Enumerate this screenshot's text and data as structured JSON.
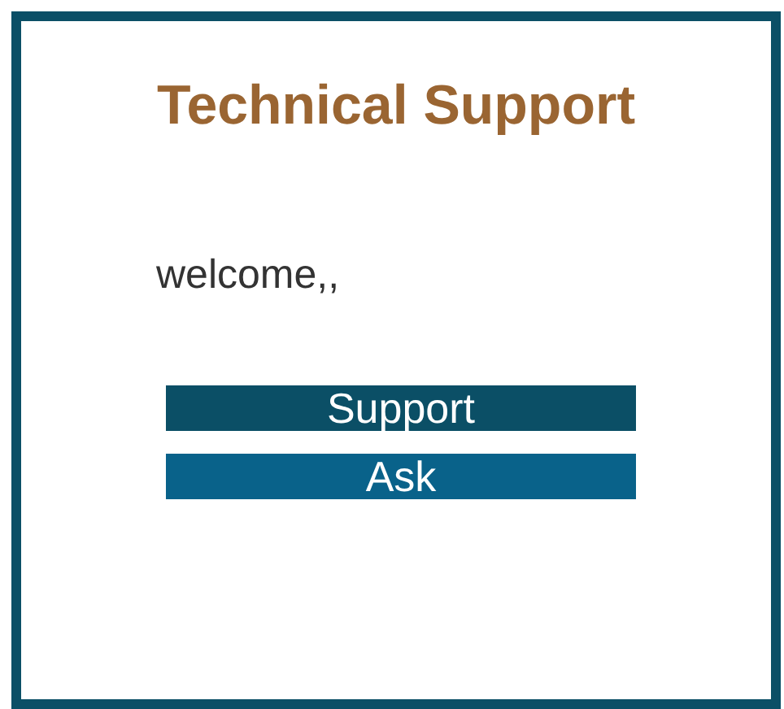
{
  "title": "Technical Support",
  "greeting": "welcome,,",
  "buttons": [
    {
      "label": "Support",
      "color": "#0b4f66"
    },
    {
      "label": "Ask",
      "color": "#09628a"
    }
  ]
}
